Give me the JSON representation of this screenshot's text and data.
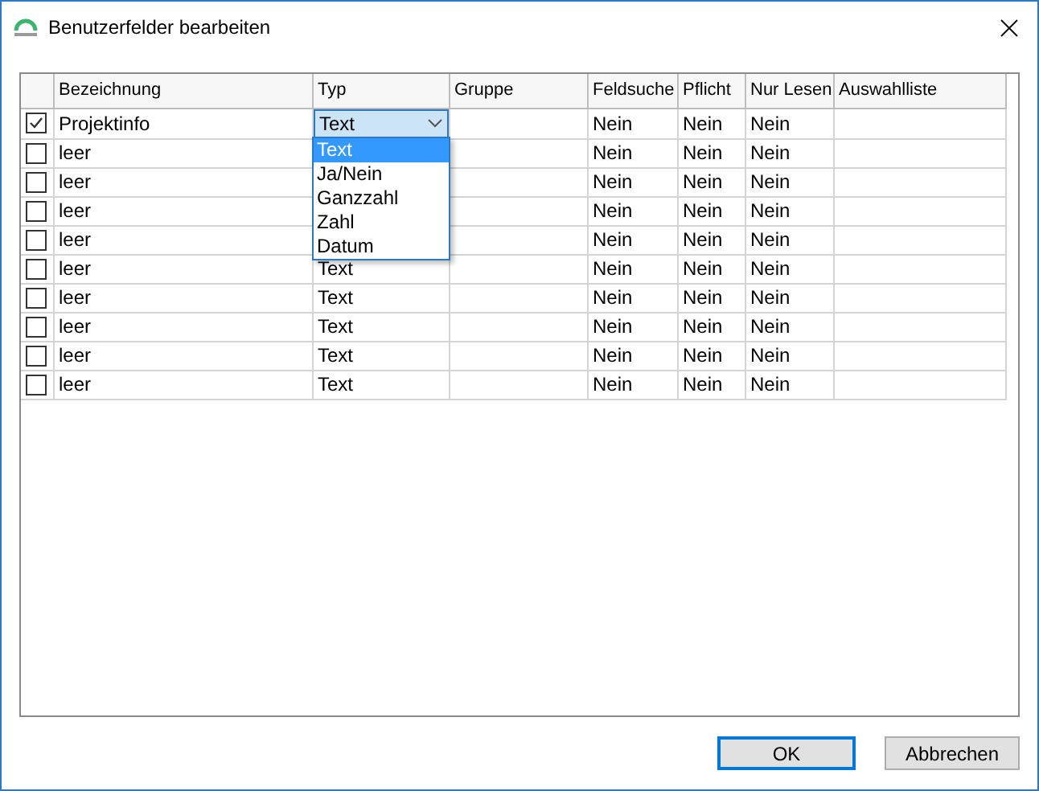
{
  "window": {
    "title": "Benutzerfelder bearbeiten"
  },
  "table": {
    "columns": [
      "Bezeichnung",
      "Typ",
      "Gruppe",
      "Feldsuche",
      "Pflicht",
      "Nur Lesen",
      "Auswahlliste"
    ],
    "rows": [
      {
        "checked": true,
        "name": "Projektinfo",
        "typ": "Text",
        "editing": true,
        "feldsuche": "Nein",
        "pflicht": "Nein",
        "nur_lesen": "Nein"
      },
      {
        "checked": false,
        "name": "leer",
        "feldsuche": "Nein",
        "pflicht": "Nein",
        "nur_lesen": "Nein"
      },
      {
        "checked": false,
        "name": "leer",
        "feldsuche": "Nein",
        "pflicht": "Nein",
        "nur_lesen": "Nein"
      },
      {
        "checked": false,
        "name": "leer",
        "feldsuche": "Nein",
        "pflicht": "Nein",
        "nur_lesen": "Nein"
      },
      {
        "checked": false,
        "name": "leer",
        "feldsuche": "Nein",
        "pflicht": "Nein",
        "nur_lesen": "Nein"
      },
      {
        "checked": false,
        "name": "leer",
        "typ": "Text",
        "editing": false,
        "feldsuche": "Nein",
        "pflicht": "Nein",
        "nur_lesen": "Nein"
      },
      {
        "checked": false,
        "name": "leer",
        "typ": "Text",
        "editing": false,
        "feldsuche": "Nein",
        "pflicht": "Nein",
        "nur_lesen": "Nein"
      },
      {
        "checked": false,
        "name": "leer",
        "typ": "Text",
        "editing": false,
        "feldsuche": "Nein",
        "pflicht": "Nein",
        "nur_lesen": "Nein"
      },
      {
        "checked": false,
        "name": "leer",
        "typ": "Text",
        "editing": false,
        "feldsuche": "Nein",
        "pflicht": "Nein",
        "nur_lesen": "Nein"
      },
      {
        "checked": false,
        "name": "leer",
        "typ": "Text",
        "editing": false,
        "feldsuche": "Nein",
        "pflicht": "Nein",
        "nur_lesen": "Nein"
      }
    ]
  },
  "dropdown": {
    "options": [
      {
        "label": "Text",
        "selected": true
      },
      {
        "label": "Ja/Nein",
        "selected": false
      },
      {
        "label": "Ganzzahl",
        "selected": false
      },
      {
        "label": "Zahl",
        "selected": false
      },
      {
        "label": "Datum",
        "selected": false
      }
    ]
  },
  "buttons": [
    {
      "label": "OK",
      "default": true
    },
    {
      "label": "Abbrechen",
      "default": false
    }
  ]
}
